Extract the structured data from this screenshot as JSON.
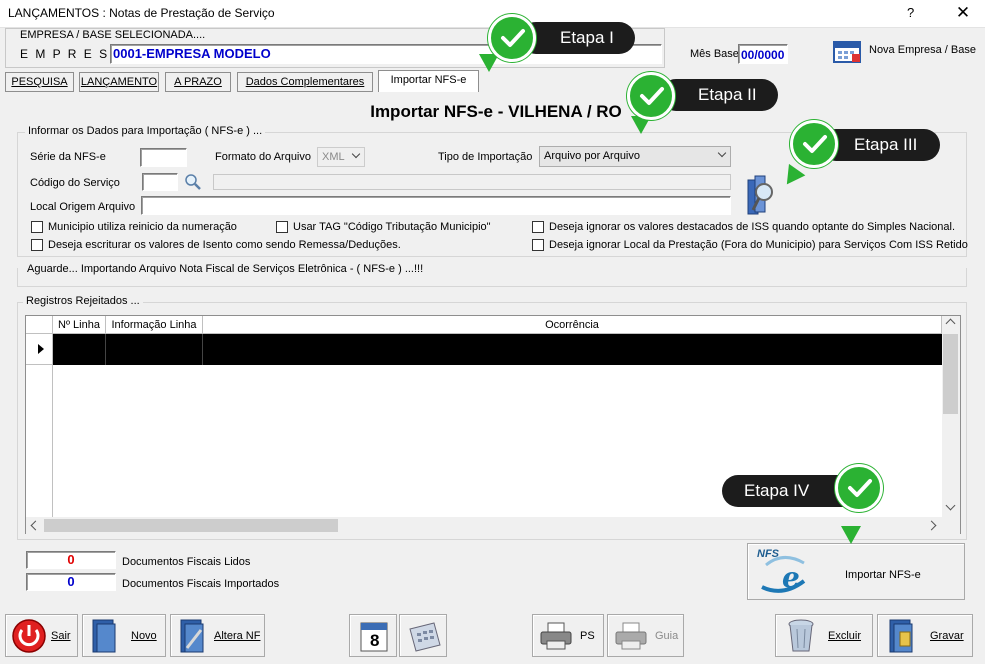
{
  "window": {
    "title": "LANÇAMENTOS : Notas de Prestação de Serviço",
    "help_label": "?",
    "close_label": "✕"
  },
  "empresa": {
    "header": "EMPRESA  /  BASE  SELECIONADA....",
    "label": "E M P R E S A",
    "value": "0001-EMPRESA MODELO",
    "mes_base_label": "Mês Base",
    "mes_base_value": "00/0000",
    "nova_button": "Nova Empresa / Base"
  },
  "tabs": [
    {
      "label": "PESQUISA"
    },
    {
      "label": "LANÇAMENTO"
    },
    {
      "label": "A PRAZO"
    },
    {
      "label": "Dados Complementares"
    },
    {
      "label": "Importar NFS-e"
    }
  ],
  "page_title": "Importar NFS-e - VILHENA / RO",
  "form": {
    "group_label": "Informar os Dados para Importação ( NFS-e ) ...",
    "serie_label": "Série da NFS-e",
    "serie_value": "",
    "formato_label": "Formato do Arquivo",
    "formato_value": "XML",
    "tipo_label": "Tipo de Importação",
    "tipo_value": "Arquivo por Arquivo",
    "codigo_label": "Código do Serviço",
    "codigo_value": "",
    "codigo_desc": "",
    "local_label": "Local Origem Arquivo",
    "local_value": "",
    "checkboxes": [
      {
        "label": "Municipio utiliza reinicio da numeração",
        "checked": false
      },
      {
        "label": "Usar TAG \"Código Tributação Municipio\"",
        "checked": false
      },
      {
        "label": "Deseja ignorar os valores destacados de ISS quando optante do Simples Nacional.",
        "checked": false
      },
      {
        "label": "Deseja escriturar os valores de Isento como sendo Remessa/Deduções.",
        "checked": false
      },
      {
        "label": "Deseja ignorar Local da Prestação (Fora do Municipio)  para Serviços Com ISS Retido",
        "checked": false
      }
    ]
  },
  "status_text": "Aguarde... Importando Arquivo Nota Fiscal de Serviços Eletrônica - ( NFS-e ) ...!!!",
  "rejected": {
    "group_label": "Registros Rejeitados ...",
    "columns": [
      "Nº Linha",
      "Informação Linha",
      "Ocorrência"
    ]
  },
  "counters": {
    "lidos_value": "0",
    "lidos_label": "Documentos Fiscais Lidos",
    "importados_value": "0",
    "importados_label": "Documentos Fiscais Importados",
    "lidos_color": "#e00000",
    "importados_color": "#0000cc"
  },
  "import_button": {
    "label": "Importar NFS-e",
    "logo_text": "NFS"
  },
  "toolbar": {
    "sair": "Sair",
    "novo": "Novo",
    "altera": "Altera NF",
    "calendar_day": "8",
    "ps": "PS",
    "guia": "Guia",
    "excluir": "Excluir",
    "gravar": "Gravar"
  },
  "callouts": [
    {
      "label": "Etapa I"
    },
    {
      "label": "Etapa II"
    },
    {
      "label": "Etapa III"
    },
    {
      "label": "Etapa IV"
    }
  ],
  "colors": {
    "accent_green": "#2bb233",
    "pill_dark": "#1c1c1c",
    "blue_text": "#0000cc"
  }
}
